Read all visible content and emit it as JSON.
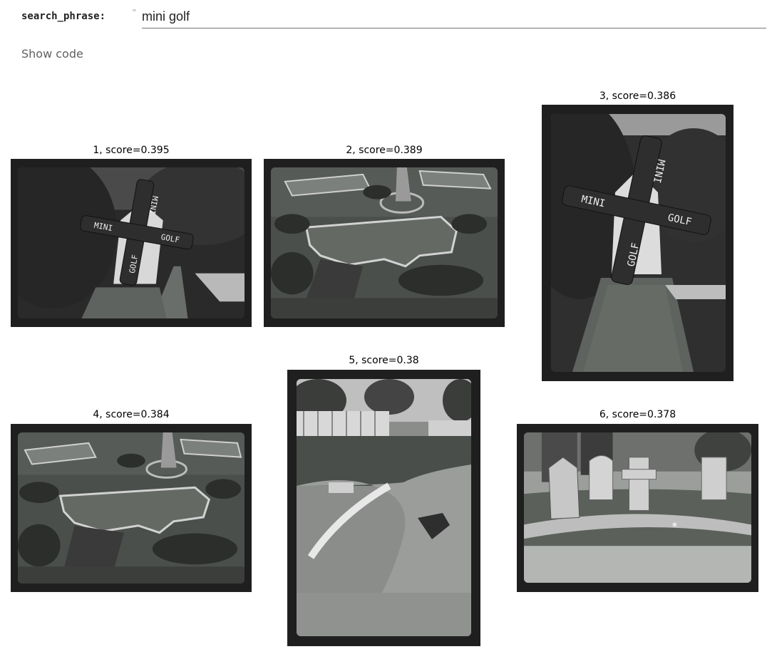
{
  "form": {
    "label": "search_phrase:",
    "quote": "\"",
    "value": "mini golf"
  },
  "show_code": "Show code",
  "results": [
    {
      "index": 1,
      "caption": "1, score=0.395",
      "score": 0.395,
      "photo": "windmill-mini-golf-sign"
    },
    {
      "index": 2,
      "caption": "2, score=0.389",
      "score": 0.389,
      "photo": "mini-golf-green-overhead"
    },
    {
      "index": 3,
      "caption": "3, score=0.386",
      "score": 0.386,
      "photo": "windmill-mini-golf-sign"
    },
    {
      "index": 4,
      "caption": "4, score=0.384",
      "score": 0.384,
      "photo": "mini-golf-green-overhead"
    },
    {
      "index": 5,
      "caption": "5, score=0.38",
      "score": 0.38,
      "photo": "curving-fairway"
    },
    {
      "index": 6,
      "caption": "6, score=0.378",
      "score": 0.378,
      "photo": "tombstone-obstacles"
    }
  ],
  "sign_text": {
    "top": "MINI",
    "left": "MINI",
    "right": "GOLF",
    "bottom": "GOLF"
  },
  "colors": {
    "frame": "#1f1f1f",
    "grass": "#5e635e",
    "foliage": "#3a3c3a",
    "border": "#cfcfcf"
  }
}
